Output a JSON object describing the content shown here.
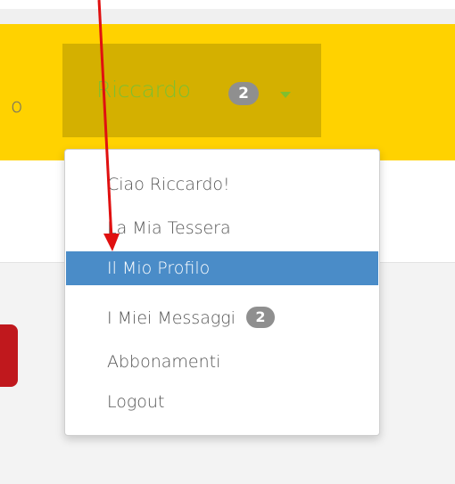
{
  "navbar": {
    "left_fragment": "o",
    "user": {
      "name": "Riccardo",
      "badge_count": "2"
    }
  },
  "dropdown": {
    "items": [
      {
        "label": "Ciao Riccardo!"
      },
      {
        "label": "La Mia Tessera"
      },
      {
        "label": "Il Mio Profilo",
        "active": true
      },
      {
        "label": "I Miei Messaggi",
        "badge": "2"
      },
      {
        "label": "Abbonamenti"
      },
      {
        "label": "Logout"
      }
    ]
  },
  "colors": {
    "navbar_bg": "#FFD200",
    "user_tab_bg": "#D4B000",
    "user_name": "#7fbf2f",
    "badge_bg": "#8f8f8f",
    "active_item_bg": "#4a8cc8",
    "annotation_arrow": "#e01010"
  }
}
